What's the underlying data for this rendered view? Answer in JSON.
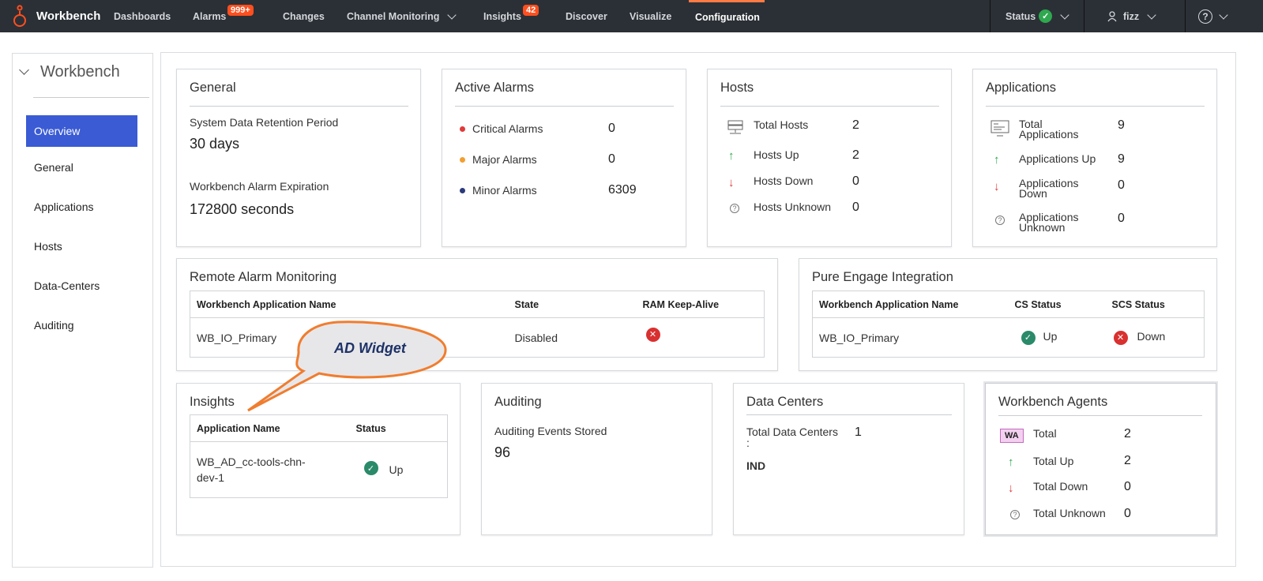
{
  "nav": {
    "brand": "Workbench",
    "items": [
      {
        "label": "Dashboards"
      },
      {
        "label": "Alarms",
        "badge": "999+"
      },
      {
        "label": "Changes"
      },
      {
        "label": "Channel Monitoring"
      },
      {
        "label": "Insights",
        "badge": "42"
      },
      {
        "label": "Discover"
      },
      {
        "label": "Visualize"
      },
      {
        "label": "Configuration"
      }
    ],
    "status_label": "Status",
    "user_label": "fizz"
  },
  "sidebar": {
    "title": "Workbench",
    "items": [
      "Overview",
      "General",
      "Applications",
      "Hosts",
      "Data-Centers",
      "Auditing"
    ]
  },
  "general": {
    "title": "General",
    "retention_label": "System Data Retention Period",
    "retention_value": "30 days",
    "expiration_label": "Workbench Alarm Expiration",
    "expiration_value": "172800 seconds"
  },
  "active_alarms": {
    "title": "Active Alarms",
    "rows": [
      {
        "label": "Critical Alarms",
        "value": "0",
        "color": "#e03a3a"
      },
      {
        "label": "Major Alarms",
        "value": "0",
        "color": "#f0a030"
      },
      {
        "label": "Minor Alarms",
        "value": "6309",
        "color": "#2a3a7a"
      }
    ]
  },
  "hosts": {
    "title": "Hosts",
    "rows": [
      {
        "label": "Total Hosts",
        "value": "2"
      },
      {
        "label": "Hosts Up",
        "value": "2"
      },
      {
        "label": "Hosts Down",
        "value": "0"
      },
      {
        "label": "Hosts Unknown",
        "value": "0"
      }
    ]
  },
  "applications": {
    "title": "Applications",
    "rows": [
      {
        "label1": "Total",
        "label2": "Applications",
        "value": "9"
      },
      {
        "label1": "Applications Up",
        "label2": "",
        "value": "9"
      },
      {
        "label1": "Applications",
        "label2": "Down",
        "value": "0"
      },
      {
        "label1": "Applications",
        "label2": "Unknown",
        "value": "0"
      }
    ]
  },
  "ram": {
    "title": "Remote Alarm Monitoring",
    "headers": [
      "Workbench Application Name",
      "State",
      "RAM Keep-Alive"
    ],
    "row": {
      "name": "WB_IO_Primary",
      "state": "Disabled"
    }
  },
  "pei": {
    "title": "Pure Engage Integration",
    "headers": [
      "Workbench Application Name",
      "CS Status",
      "SCS Status"
    ],
    "row": {
      "name": "WB_IO_Primary",
      "cs": "Up",
      "scs": "Down"
    }
  },
  "callout": {
    "label": "AD Widget"
  },
  "insights": {
    "title": "Insights",
    "headers": [
      "Application Name",
      "Status"
    ],
    "row": {
      "name1": "WB_AD_cc-tools-chn-",
      "name2": "dev-1",
      "status": "Up"
    }
  },
  "auditing": {
    "title": "Auditing",
    "label": "Auditing Events Stored",
    "value": "96"
  },
  "data_centers": {
    "title": "Data Centers",
    "label1": "Total Data Centers",
    "label2": ":",
    "value": "1",
    "item": "IND"
  },
  "agents": {
    "title": "Workbench Agents",
    "badge": "WA",
    "rows": [
      {
        "label": "Total",
        "value": "2"
      },
      {
        "label": "Total Up",
        "value": "2"
      },
      {
        "label": "Total Down",
        "value": "0"
      },
      {
        "label": "Total Unknown",
        "value": "0"
      }
    ]
  },
  "colors": {
    "accent": "#3a5bd4",
    "nav_bg": "#2b3036",
    "badge": "#ff4f1f",
    "up": "#2a8a6a",
    "down": "#d93030"
  }
}
